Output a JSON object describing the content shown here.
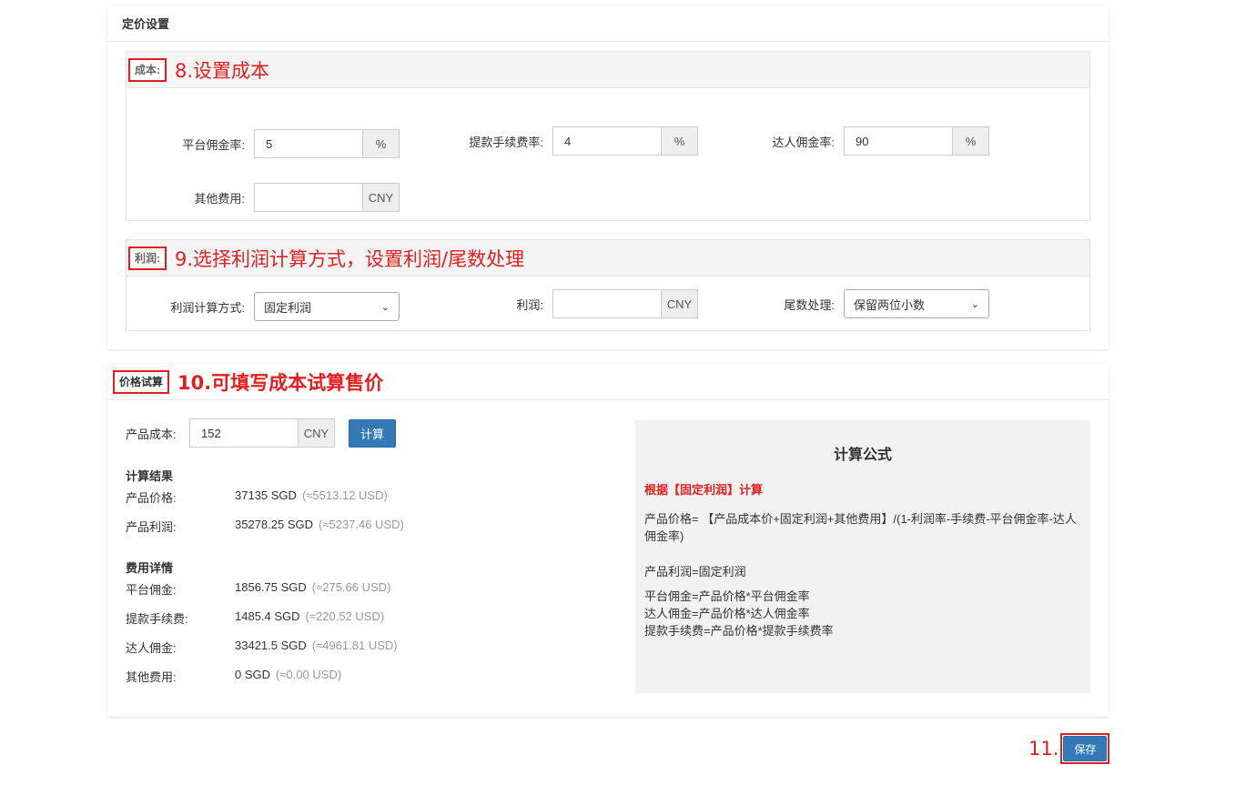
{
  "pricing_panel": {
    "title": "定价设置",
    "cost_section": {
      "label": "成本:",
      "annotation": "8.设置成本",
      "platform_commission": {
        "label": "平台佣金率:",
        "value": "5",
        "unit": "%"
      },
      "withdraw_fee": {
        "label": "提款手续费率:",
        "value": "4",
        "unit": "%"
      },
      "influencer_commission": {
        "label": "达人佣金率:",
        "value": "90",
        "unit": "%"
      },
      "other_fee": {
        "label": "其他费用:",
        "value": "",
        "unit": "CNY"
      }
    },
    "profit_section": {
      "label": "利润:",
      "annotation": "9.选择利润计算方式，设置利润/尾数处理",
      "method": {
        "label": "利润计算方式:",
        "selected": "固定利润"
      },
      "profit": {
        "label": "利润:",
        "value": "",
        "unit": "CNY"
      },
      "rounding": {
        "label": "尾数处理:",
        "selected": "保留两位小数"
      }
    }
  },
  "trial_panel": {
    "title": "价格试算",
    "annotation": "10.可填写成本试算售价",
    "product_cost": {
      "label": "产品成本:",
      "value": "152",
      "unit": "CNY"
    },
    "calc_button": "计算",
    "results_title": "计算结果",
    "results": [
      {
        "key": "产品价格:",
        "value": "37135 SGD",
        "approx": "(≈5513.12 USD)"
      },
      {
        "key": "产品利润:",
        "value": "35278.25 SGD",
        "approx": "(≈5237.46 USD)"
      }
    ],
    "fees_title": "费用详情",
    "fees": [
      {
        "key": "平台佣金:",
        "value": "1856.75 SGD",
        "approx": "(≈275.66 USD)"
      },
      {
        "key": "提款手续费:",
        "value": "1485.4 SGD",
        "approx": "(≈220.52 USD)"
      },
      {
        "key": "达人佣金:",
        "value": "33421.5 SGD",
        "approx": "(≈4961.81 USD)"
      },
      {
        "key": "其他费用:",
        "value": "0 SGD",
        "approx": "(≈0.00 USD)"
      }
    ],
    "formula": {
      "title": "计算公式",
      "subtitle": "根据【固定利润】计算",
      "price_formula": "产品价格= 【产品成本价+固定利润+其他费用】/(1-利润率-手续费-平台佣金率-达人佣金率)",
      "profit_formula": "产品利润=固定利润",
      "platform_formula": "平台佣金=产品价格*平台佣金率",
      "influencer_formula": "达人佣金=产品价格*达人佣金率",
      "withdraw_formula": "提款手续费=产品价格*提款手续费率"
    }
  },
  "footer": {
    "annotation": "11.",
    "save_button": "保存"
  },
  "colors": {
    "accent": "#337ab7",
    "annotation": "#e02020"
  }
}
